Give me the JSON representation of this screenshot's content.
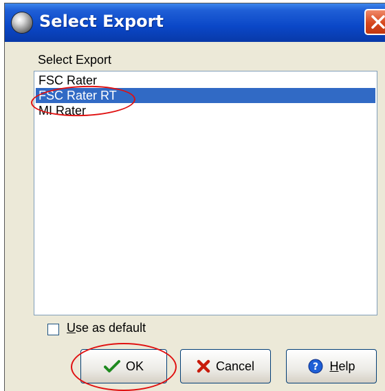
{
  "window": {
    "title": "Select Export"
  },
  "group_label": "Select Export",
  "list": {
    "items": [
      {
        "label": "FSC Rater",
        "selected": false
      },
      {
        "label": "FSC Rater RT",
        "selected": true
      },
      {
        "label": "MI Rater",
        "selected": false
      }
    ]
  },
  "checkbox": {
    "label_underlined": "U",
    "label_rest": "se as default",
    "checked": false
  },
  "buttons": {
    "ok": {
      "label": "OK"
    },
    "cancel": {
      "label": "Cancel"
    },
    "help": {
      "label_underlined": "H",
      "label_rest": "elp"
    }
  },
  "colors": {
    "titlebar": "#0a47c7",
    "selection": "#316ac5",
    "annotation": "#e01010"
  }
}
